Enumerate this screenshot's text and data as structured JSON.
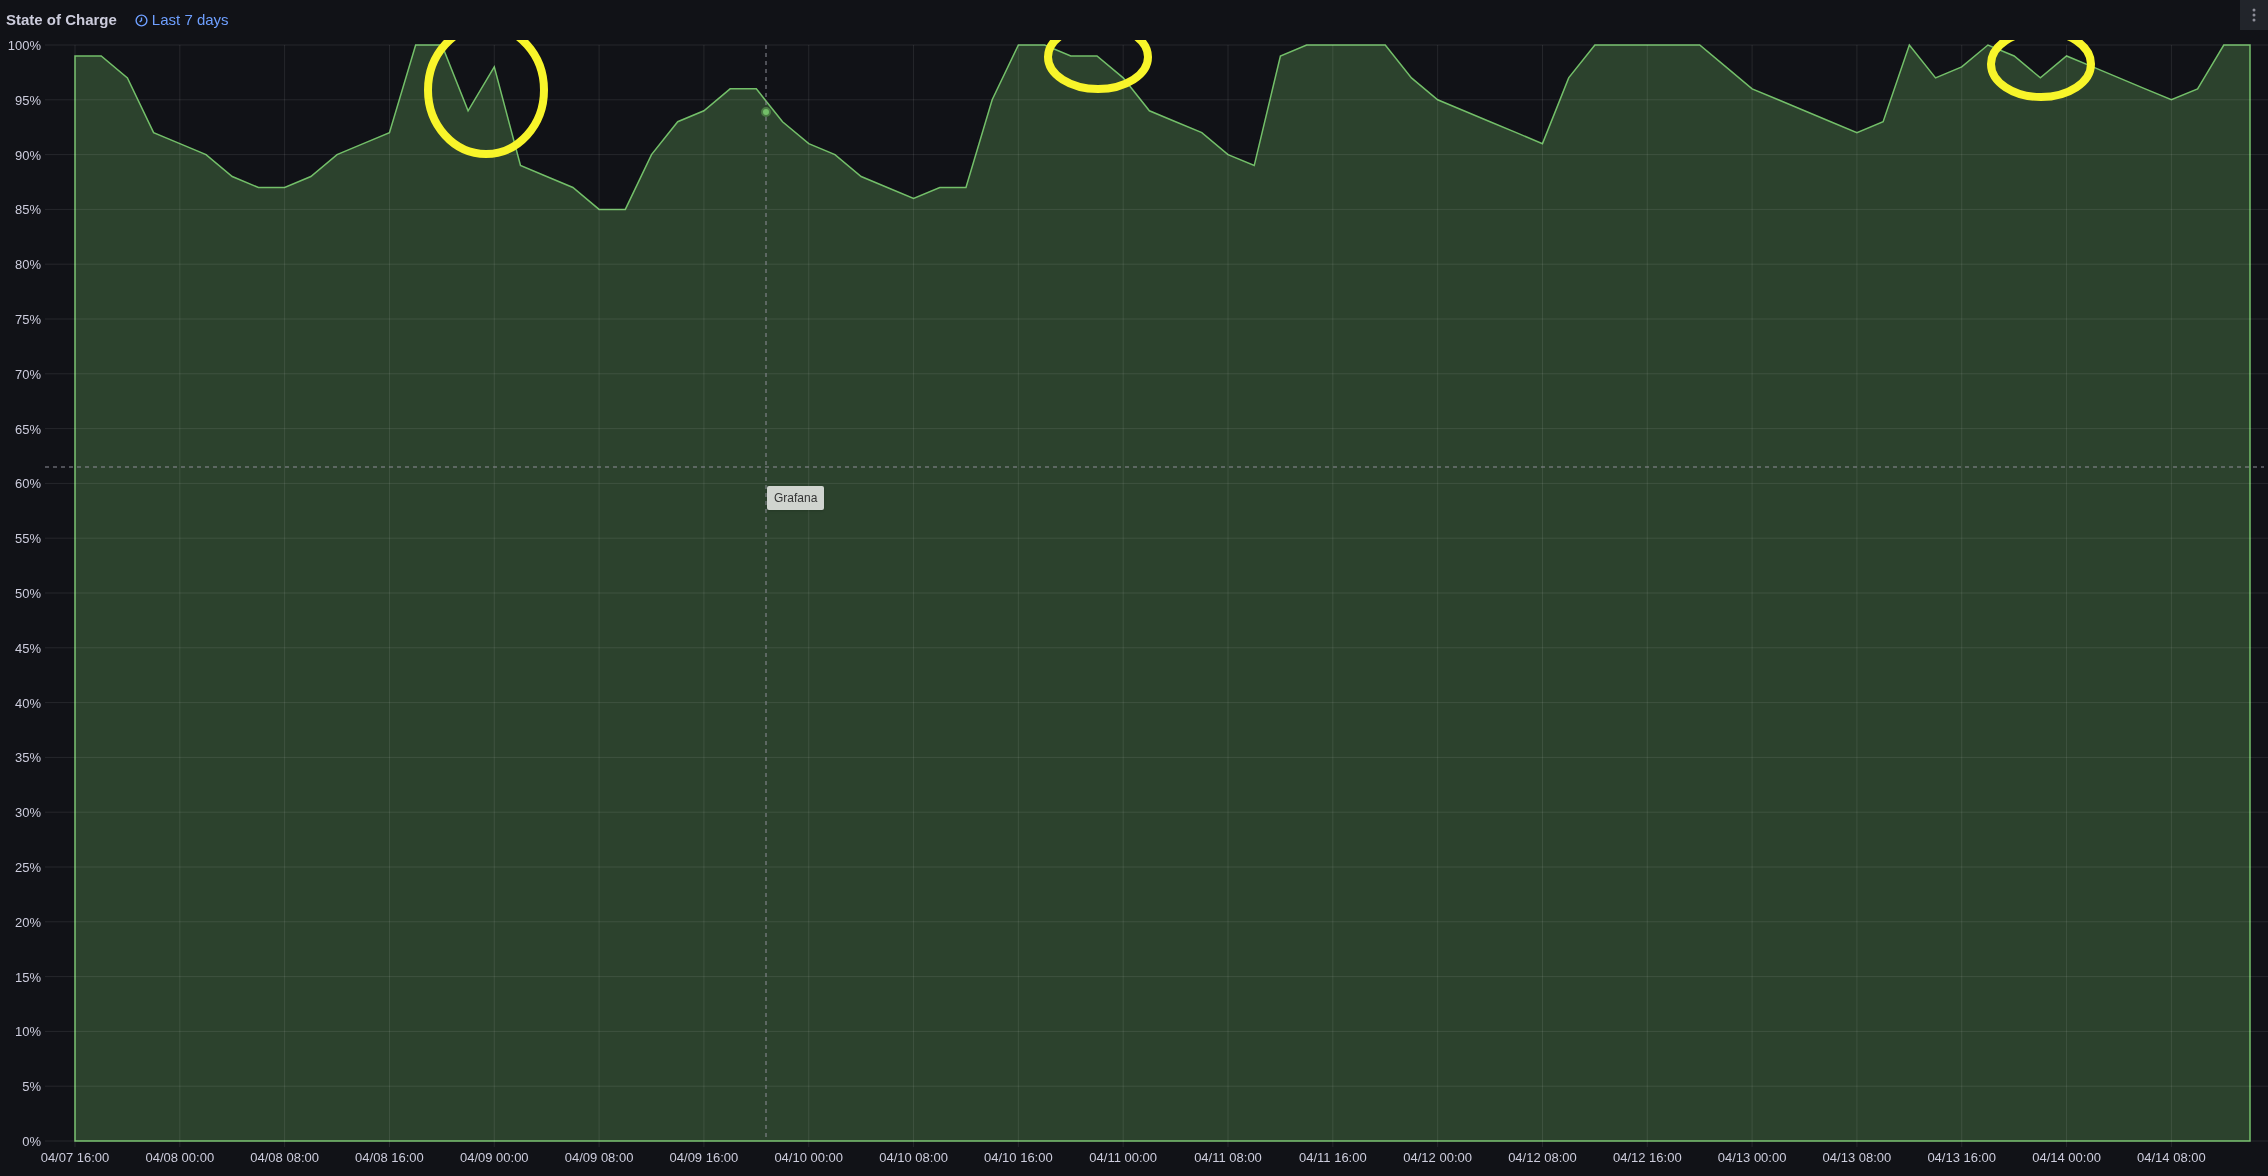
{
  "panel": {
    "title": "State of Charge",
    "time_range": "Last 7 days"
  },
  "tooltip": {
    "text": "Grafana"
  },
  "chart_data": {
    "type": "area",
    "ylim": [
      0,
      100
    ],
    "grid": true,
    "yticks": [
      {
        "value": 0,
        "label": "0%"
      },
      {
        "value": 5,
        "label": "5%"
      },
      {
        "value": 10,
        "label": "10%"
      },
      {
        "value": 15,
        "label": "15%"
      },
      {
        "value": 20,
        "label": "20%"
      },
      {
        "value": 25,
        "label": "25%"
      },
      {
        "value": 30,
        "label": "30%"
      },
      {
        "value": 35,
        "label": "35%"
      },
      {
        "value": 40,
        "label": "40%"
      },
      {
        "value": 45,
        "label": "45%"
      },
      {
        "value": 50,
        "label": "50%"
      },
      {
        "value": 55,
        "label": "55%"
      },
      {
        "value": 60,
        "label": "60%"
      },
      {
        "value": 65,
        "label": "65%"
      },
      {
        "value": 70,
        "label": "70%"
      },
      {
        "value": 75,
        "label": "75%"
      },
      {
        "value": 80,
        "label": "80%"
      },
      {
        "value": 85,
        "label": "85%"
      },
      {
        "value": 90,
        "label": "90%"
      },
      {
        "value": 95,
        "label": "95%"
      },
      {
        "value": 100,
        "label": "100%"
      }
    ],
    "categories": [
      "04/07 16:00",
      null,
      null,
      null,
      "04/08 00:00",
      null,
      null,
      null,
      "04/08 08:00",
      null,
      null,
      null,
      "04/08 16:00",
      null,
      null,
      null,
      "04/09 00:00",
      null,
      null,
      null,
      "04/09 08:00",
      null,
      null,
      null,
      "04/09 16:00",
      null,
      null,
      null,
      "04/10 00:00",
      null,
      null,
      null,
      "04/10 08:00",
      null,
      null,
      null,
      "04/10 16:00",
      null,
      null,
      null,
      "04/11 00:00",
      null,
      null,
      null,
      "04/11 08:00",
      null,
      null,
      null,
      "04/11 16:00",
      null,
      null,
      null,
      "04/12 00:00",
      null,
      null,
      null,
      "04/12 08:00",
      null,
      null,
      null,
      "04/12 16:00",
      null,
      null,
      null,
      "04/13 00:00",
      null,
      null,
      null,
      "04/13 08:00",
      null,
      null,
      null,
      "04/13 16:00",
      null,
      null,
      null,
      "04/14 00:00",
      null,
      null,
      null,
      "04/14 08:00",
      null,
      null,
      null
    ],
    "series": [
      {
        "color": "#73bf69",
        "values": [
          99,
          99,
          97,
          92,
          91,
          90,
          88,
          87,
          87,
          88,
          90,
          91,
          92,
          100,
          100,
          94,
          98,
          89,
          88,
          87,
          85,
          85,
          90,
          93,
          94,
          96,
          96,
          93,
          91,
          90,
          88,
          87,
          86,
          87,
          87,
          95,
          100,
          100,
          99,
          99,
          97,
          94,
          93,
          92,
          90,
          89,
          99,
          100,
          100,
          100,
          100,
          97,
          95,
          94,
          93,
          92,
          91,
          97,
          100,
          100,
          100,
          100,
          100,
          98,
          96,
          95,
          94,
          93,
          92,
          93,
          100,
          97,
          98,
          100,
          99,
          97,
          99,
          98,
          97,
          96,
          95,
          96,
          100,
          100
        ]
      }
    ]
  }
}
